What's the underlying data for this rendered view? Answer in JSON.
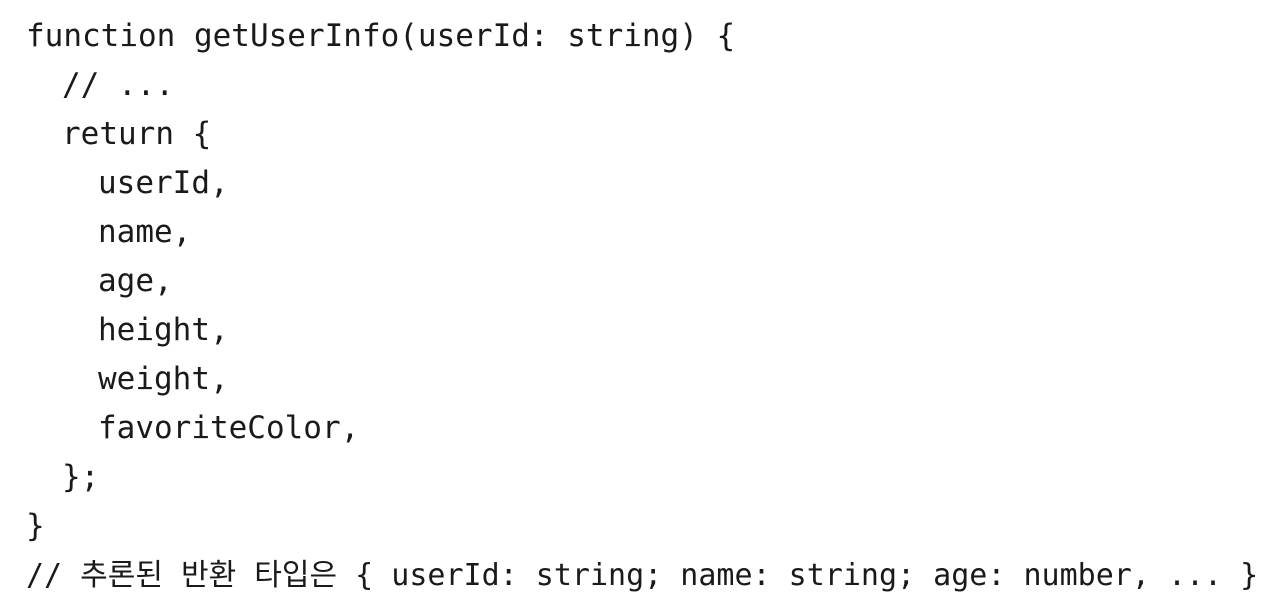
{
  "code": {
    "lines": [
      {
        "text": "function getUserInfo(userId: string) {",
        "indent": 0
      },
      {
        "text": "// ...",
        "indent": 1
      },
      {
        "text": "return {",
        "indent": 1
      },
      {
        "text": "userId,",
        "indent": 2
      },
      {
        "text": "name,",
        "indent": 2
      },
      {
        "text": "age,",
        "indent": 2
      },
      {
        "text": "height,",
        "indent": 2
      },
      {
        "text": "weight,",
        "indent": 2
      },
      {
        "text": "favoriteColor,",
        "indent": 2
      },
      {
        "text": "};",
        "indent": 1
      },
      {
        "text": "}",
        "indent": 0
      },
      {
        "text": "// 추론된 반환 타입은 { userId: string; name: string; age: number, ... }",
        "indent": 0
      }
    ]
  }
}
